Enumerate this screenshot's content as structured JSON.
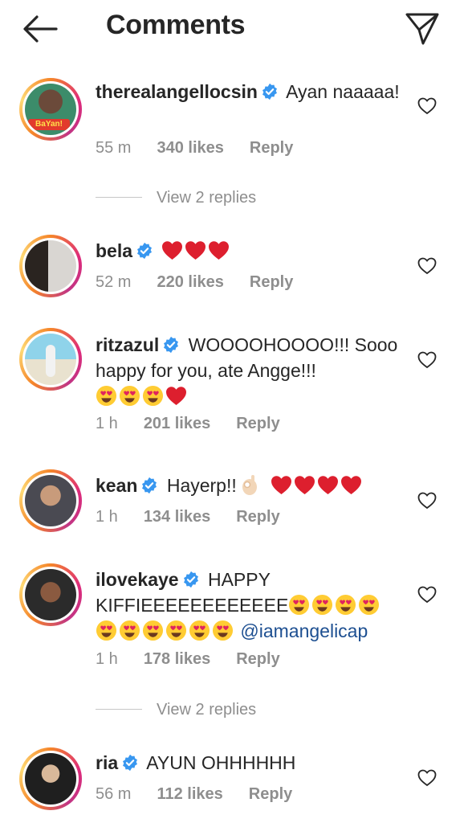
{
  "header": {
    "title": "Comments"
  },
  "comments": [
    {
      "user": "therealangellocsin",
      "text": "Ayan naaaaa!",
      "time": "55 m",
      "likes": "340 likes",
      "reply": "Reply"
    },
    {
      "user": "bela",
      "time": "52 m",
      "likes": "220 likes",
      "reply": "Reply"
    },
    {
      "user": "ritzazul",
      "text": "WOOOOHOOOO!!! Sooo happy for you, ate Angge!!!",
      "time": "1 h",
      "likes": "201 likes",
      "reply": "Reply"
    },
    {
      "user": "kean",
      "text": "Hayerp!!",
      "time": "1 h",
      "likes": "134 likes",
      "reply": "Reply"
    },
    {
      "user": "ilovekaye",
      "text": "HAPPY KIFFIEEEEEEEEEEEE",
      "mention": "@iamangelicap",
      "time": "1 h",
      "likes": "178 likes",
      "reply": "Reply"
    },
    {
      "user": "ria",
      "text": "AYUN OHHHHHH",
      "time": "56 m",
      "likes": "112 likes",
      "reply": "Reply"
    }
  ],
  "replies_links": [
    "View 2 replies",
    "View 2 replies"
  ],
  "avatar_badge_text": "BaYan!",
  "colors": {
    "verified": "#3897f0",
    "heart": "#e0245e",
    "muted": "#8e8e8e"
  }
}
